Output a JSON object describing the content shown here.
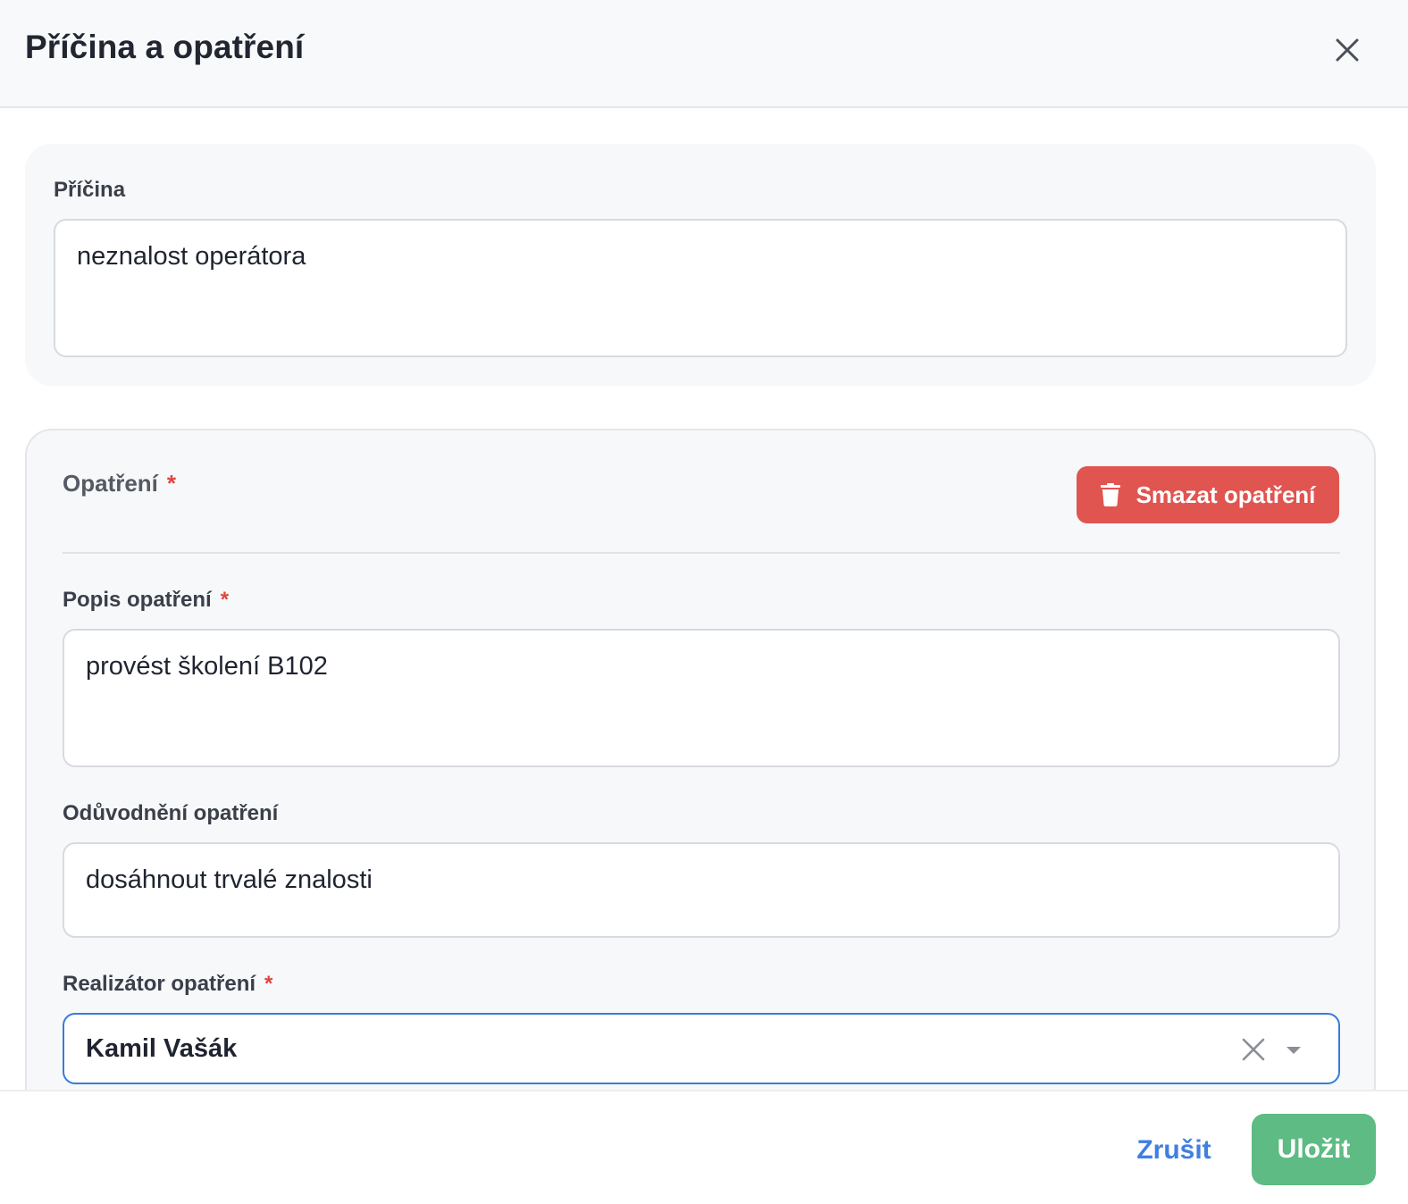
{
  "dialog": {
    "title": "Příčina a opatření"
  },
  "cause": {
    "label": "Příčina",
    "value": "neznalost operátora"
  },
  "measure": {
    "title": "Opatření",
    "required_mark": "*",
    "delete_label": "Smazat opatření",
    "description": {
      "label": "Popis opatření",
      "required_mark": "*",
      "value": "provést školení B102"
    },
    "justification": {
      "label": "Odůvodnění opatření",
      "value": "dosáhnout trvalé znalosti"
    },
    "implementer": {
      "label": "Realizátor opatření",
      "required_mark": "*",
      "value": "Kamil Vašák"
    }
  },
  "footer": {
    "cancel_label": "Zrušit",
    "save_label": "Uložit"
  },
  "colors": {
    "danger": "#e05550",
    "success": "#5dbb83",
    "link": "#3f7fe0",
    "focus_border": "#3b7bd8",
    "required": "#e0443c"
  },
  "icons": {
    "close": "close-icon",
    "delete": "trash-icon",
    "clear": "clear-icon",
    "dropdown": "chevron-down-icon"
  }
}
